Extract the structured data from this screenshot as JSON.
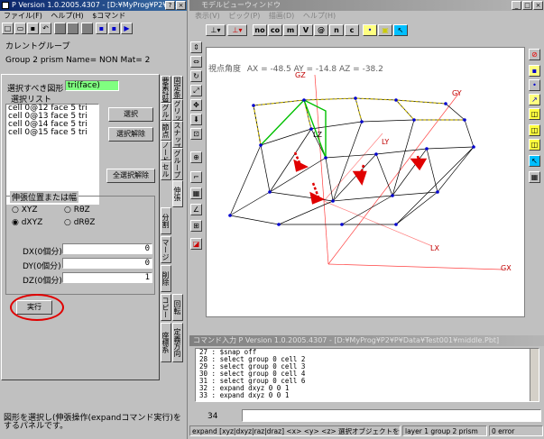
{
  "left_window": {
    "title": "P Version 1.0.2005.4307 - [D:¥MyProg¥P2¥P...",
    "menu": [
      "ファイル(F)",
      "ヘルプ(H)",
      "$コマンド"
    ],
    "current_group_label": "カレントグループ",
    "current_group_value": "Group 2 prism Name= NON Mat= 2",
    "select_shape_label": "選択すべき図形",
    "select_shape_value": "tri(face)",
    "select_list_label": "選択リスト",
    "select_list": [
      "cell 0@12 face 5 tri",
      "cell 0@13 face 5 tri",
      "cell 0@14 face 5 tri",
      "cell 0@15 face 5 tri"
    ],
    "btn_select": "選択",
    "btn_deselect": "選択解除",
    "btn_deselect_all": "全選択解除",
    "tabs_right": [
      "要素計算",
      "グルー",
      "固定条件",
      "グリッド",
      "節点",
      "ノード",
      "スナップ",
      "セル",
      "グループ",
      "分割",
      "伸張",
      "マージ",
      "削除",
      "コピー",
      "回転",
      "座標系",
      "定義方向"
    ],
    "expand_group_title": "伸張位置または幅",
    "radio_xyz": "XYZ",
    "radio_rtz": "RθZ",
    "radio_dxyz": "dXYZ",
    "radio_drtz": "dRθZ",
    "dx_label": "DX(0個分)",
    "dy_label": "DY(0個分)",
    "dz_label": "DZ(0個分)",
    "dx_value": "0",
    "dy_value": "0",
    "dz_value": "1",
    "btn_execute": "実行",
    "status_text": "図形を選択し(伸張操作(expandコマンド実行)をするパネルです。"
  },
  "viewer": {
    "title": "モデルビューウィンドウ",
    "menu": [
      "表示(V)",
      "ピック(P)",
      "描画(D)",
      "ヘルプ(H)"
    ],
    "toolbar": [
      "no",
      "co",
      "m",
      "V",
      "@",
      "n",
      "c"
    ],
    "view_angle_label": "視点角度",
    "view_angle": "AX = -48.5  AY = -14.8   AZ = -38.2",
    "axis_labels": [
      "GZ",
      "GY",
      "GX",
      "LX",
      "LY",
      "LZ"
    ]
  },
  "command_window": {
    "title": "コマンド入力  P Version 1.0.2005.4307 - [D:¥MyProg¥P2¥P¥Data¥Test001¥middle.Pbt]",
    "log": [
      "27 : $snap off",
      "28 : select group 0 cell 2",
      "29 : select group 0 cell 3",
      "30 : select group 0 cell 4",
      "31 : select group 0 cell 6",
      "32 : expand dxyz 0 0 1",
      "33 : expand dxyz 0 0 1"
    ],
    "line_number": "34",
    "status_hint": "expand [xyz|dxyz|raz|draz] <x> <y> <z>  選択オブジェクトを伸張",
    "status_layer": "layer 1 group 2 prism",
    "status_error": "0 error"
  },
  "colors": {
    "accent": "#0a246a",
    "highlight_field": "#80ff80",
    "arrow": "#e00000",
    "selected_face": "#00c000"
  }
}
